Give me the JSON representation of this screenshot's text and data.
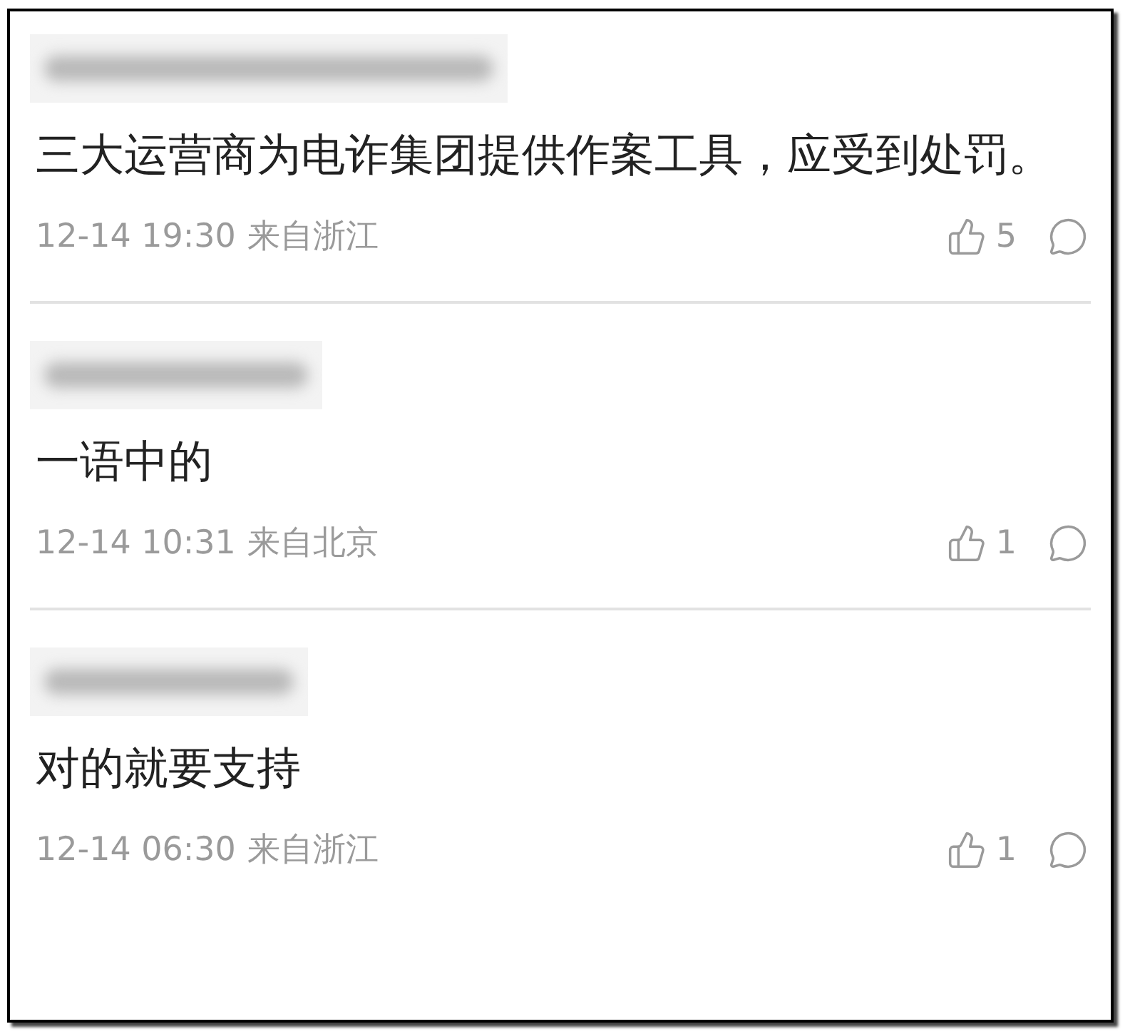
{
  "comments": [
    {
      "text": "三大运营商为电诈集团提供作案工具，应受到处罚。",
      "time": "12-14 19:30",
      "location": "来自浙江",
      "likes": "5"
    },
    {
      "text": "一语中的",
      "time": "12-14 10:31",
      "location": "来自北京",
      "likes": "1"
    },
    {
      "text": "对的就要支持",
      "time": "12-14 06:30",
      "location": "来自浙江",
      "likes": "1"
    }
  ]
}
